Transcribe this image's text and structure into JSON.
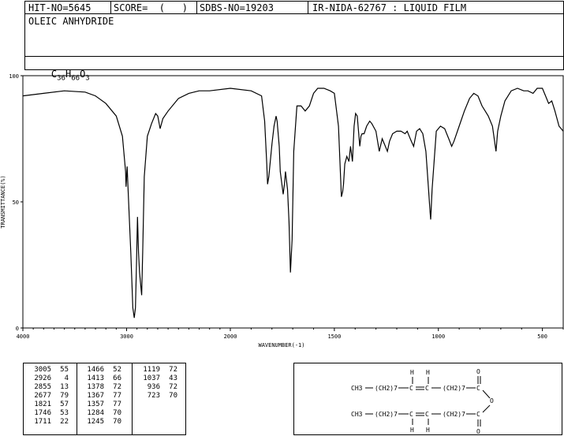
{
  "header": {
    "hit_no": "HIT-NO=5645",
    "score": "SCORE=  (   )",
    "sdbs_no": "SDBS-NO=19203",
    "ir_nida": "IR-NIDA-62767 : LIQUID FILM"
  },
  "compound_name": "OLEIC ANHYDRIDE",
  "formula": {
    "c": "C",
    "c_n": "36",
    "h": "H",
    "h_n": "66",
    "o": "O",
    "o_n": "3"
  },
  "chart_data": {
    "type": "line",
    "xlabel": "WAVENUMBER(-1)",
    "ylabel": "TRANSMITTANCE(%)",
    "xlim": [
      4000,
      400
    ],
    "ylim": [
      0,
      100
    ],
    "x_ticks": [
      4000,
      3000,
      2000,
      1500,
      1000,
      500
    ],
    "y_ticks": [
      0,
      50,
      100
    ],
    "points": [
      [
        4000,
        92
      ],
      [
        3800,
        93
      ],
      [
        3600,
        94
      ],
      [
        3400,
        93.5
      ],
      [
        3300,
        92
      ],
      [
        3200,
        89
      ],
      [
        3100,
        84
      ],
      [
        3040,
        76
      ],
      [
        3010,
        62
      ],
      [
        3005,
        56
      ],
      [
        2995,
        64
      ],
      [
        2985,
        54
      ],
      [
        2960,
        30
      ],
      [
        2940,
        8
      ],
      [
        2926,
        4
      ],
      [
        2915,
        8
      ],
      [
        2905,
        25
      ],
      [
        2895,
        44
      ],
      [
        2885,
        30
      ],
      [
        2875,
        22
      ],
      [
        2855,
        13
      ],
      [
        2845,
        30
      ],
      [
        2830,
        60
      ],
      [
        2800,
        76
      ],
      [
        2760,
        81
      ],
      [
        2720,
        85
      ],
      [
        2700,
        84
      ],
      [
        2677,
        79
      ],
      [
        2650,
        83
      ],
      [
        2600,
        86
      ],
      [
        2500,
        91
      ],
      [
        2400,
        93
      ],
      [
        2300,
        94
      ],
      [
        2200,
        94
      ],
      [
        2000,
        95
      ],
      [
        1900,
        94
      ],
      [
        1850,
        92
      ],
      [
        1835,
        82
      ],
      [
        1825,
        65
      ],
      [
        1821,
        57
      ],
      [
        1815,
        60
      ],
      [
        1800,
        73
      ],
      [
        1790,
        80
      ],
      [
        1780,
        84
      ],
      [
        1775,
        82
      ],
      [
        1765,
        72
      ],
      [
        1760,
        62
      ],
      [
        1746,
        53
      ],
      [
        1740,
        57
      ],
      [
        1735,
        62
      ],
      [
        1725,
        55
      ],
      [
        1718,
        42
      ],
      [
        1711,
        22
      ],
      [
        1703,
        35
      ],
      [
        1695,
        70
      ],
      [
        1680,
        88
      ],
      [
        1660,
        88
      ],
      [
        1640,
        86
      ],
      [
        1620,
        88
      ],
      [
        1600,
        93
      ],
      [
        1580,
        95
      ],
      [
        1550,
        95
      ],
      [
        1520,
        94
      ],
      [
        1500,
        93
      ],
      [
        1480,
        80
      ],
      [
        1466,
        52
      ],
      [
        1460,
        54
      ],
      [
        1456,
        57
      ],
      [
        1450,
        65
      ],
      [
        1440,
        68
      ],
      [
        1430,
        66
      ],
      [
        1422,
        72
      ],
      [
        1413,
        66
      ],
      [
        1405,
        80
      ],
      [
        1398,
        85
      ],
      [
        1390,
        84
      ],
      [
        1378,
        72
      ],
      [
        1372,
        76
      ],
      [
        1367,
        77
      ],
      [
        1362,
        77
      ],
      [
        1357,
        77
      ],
      [
        1345,
        80
      ],
      [
        1330,
        82
      ],
      [
        1320,
        81
      ],
      [
        1300,
        78
      ],
      [
        1284,
        70
      ],
      [
        1270,
        75
      ],
      [
        1260,
        73
      ],
      [
        1245,
        70
      ],
      [
        1235,
        74
      ],
      [
        1220,
        77
      ],
      [
        1200,
        78
      ],
      [
        1180,
        78
      ],
      [
        1160,
        77
      ],
      [
        1150,
        78
      ],
      [
        1140,
        76
      ],
      [
        1130,
        74
      ],
      [
        1119,
        72
      ],
      [
        1105,
        78
      ],
      [
        1090,
        79
      ],
      [
        1075,
        77
      ],
      [
        1060,
        70
      ],
      [
        1050,
        58
      ],
      [
        1040,
        46
      ],
      [
        1037,
        43
      ],
      [
        1030,
        55
      ],
      [
        1010,
        78
      ],
      [
        990,
        80
      ],
      [
        970,
        79
      ],
      [
        950,
        75
      ],
      [
        936,
        72
      ],
      [
        925,
        74
      ],
      [
        900,
        80
      ],
      [
        875,
        86
      ],
      [
        850,
        91
      ],
      [
        830,
        93
      ],
      [
        810,
        92
      ],
      [
        790,
        88
      ],
      [
        775,
        86
      ],
      [
        760,
        84
      ],
      [
        740,
        80
      ],
      [
        730,
        74
      ],
      [
        723,
        70
      ],
      [
        715,
        78
      ],
      [
        700,
        84
      ],
      [
        680,
        90
      ],
      [
        650,
        94
      ],
      [
        620,
        95
      ],
      [
        590,
        94
      ],
      [
        570,
        94
      ],
      [
        545,
        93
      ],
      [
        525,
        95
      ],
      [
        500,
        95
      ],
      [
        485,
        92
      ],
      [
        470,
        89
      ],
      [
        455,
        90
      ],
      [
        440,
        86
      ],
      [
        420,
        80
      ],
      [
        400,
        78
      ]
    ]
  },
  "peak_table": {
    "col1": [
      [
        "3005",
        "55"
      ],
      [
        "2926",
        "4"
      ],
      [
        "2855",
        "13"
      ],
      [
        "2677",
        "79"
      ],
      [
        "1821",
        "57"
      ],
      [
        "1746",
        "53"
      ],
      [
        "1711",
        "22"
      ]
    ],
    "col2": [
      [
        "1466",
        "52"
      ],
      [
        "1413",
        "66"
      ],
      [
        "1378",
        "72"
      ],
      [
        "1367",
        "77"
      ],
      [
        "1357",
        "77"
      ],
      [
        "1284",
        "70"
      ],
      [
        "1245",
        "70"
      ]
    ],
    "col3": [
      [
        "1119",
        "72"
      ],
      [
        "1037",
        "43"
      ],
      [
        "936",
        "72"
      ],
      [
        "723",
        "70"
      ]
    ]
  },
  "structure": {
    "h": "H",
    "ch3": "CH3",
    "ch2_7": "(CH2)7",
    "c": "C",
    "o": "O",
    "ch2_7b": "(CH2)7"
  }
}
